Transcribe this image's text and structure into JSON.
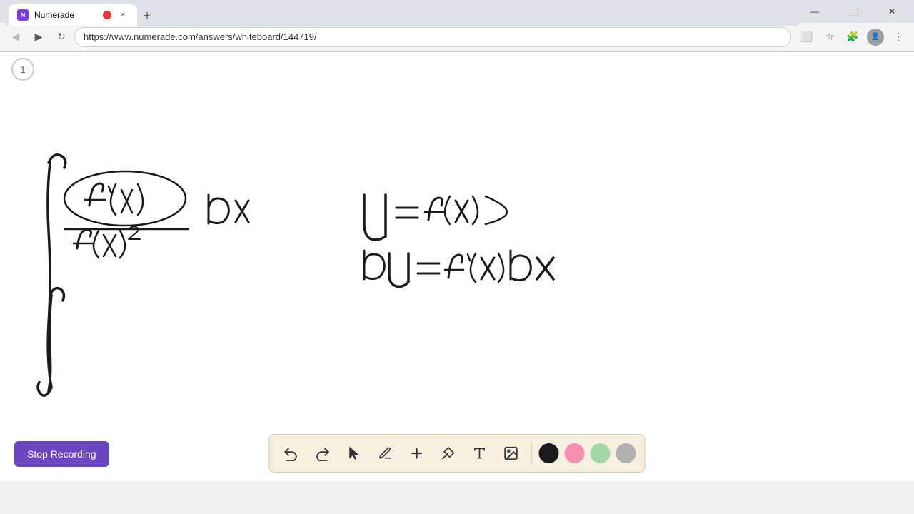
{
  "browser": {
    "tab_favicon": "N",
    "tab_title": "Numerade",
    "tab_url": "https://www.numerade.com/answers/whiteboard/144719/",
    "recording_indicator": true,
    "nav": {
      "back": "◀",
      "forward": "▶",
      "refresh": "↻"
    }
  },
  "toolbar": {
    "stop_recording_label": "Stop Recording",
    "tools": [
      {
        "name": "undo",
        "icon": "↩",
        "label": "Undo"
      },
      {
        "name": "redo",
        "icon": "↪",
        "label": "Redo"
      },
      {
        "name": "select",
        "icon": "▲",
        "label": "Select"
      },
      {
        "name": "pen",
        "icon": "✏",
        "label": "Pen"
      },
      {
        "name": "add",
        "icon": "+",
        "label": "Add"
      },
      {
        "name": "highlighter",
        "icon": "/",
        "label": "Highlighter"
      },
      {
        "name": "text",
        "icon": "A",
        "label": "Text"
      },
      {
        "name": "image",
        "icon": "🖼",
        "label": "Image"
      }
    ],
    "colors": [
      {
        "name": "black",
        "hex": "#1a1a1a"
      },
      {
        "name": "pink",
        "hex": "#f48fb1"
      },
      {
        "name": "green",
        "hex": "#a5d6a7"
      },
      {
        "name": "gray",
        "hex": "#b0b0b0"
      }
    ]
  },
  "page": {
    "number": "1"
  }
}
